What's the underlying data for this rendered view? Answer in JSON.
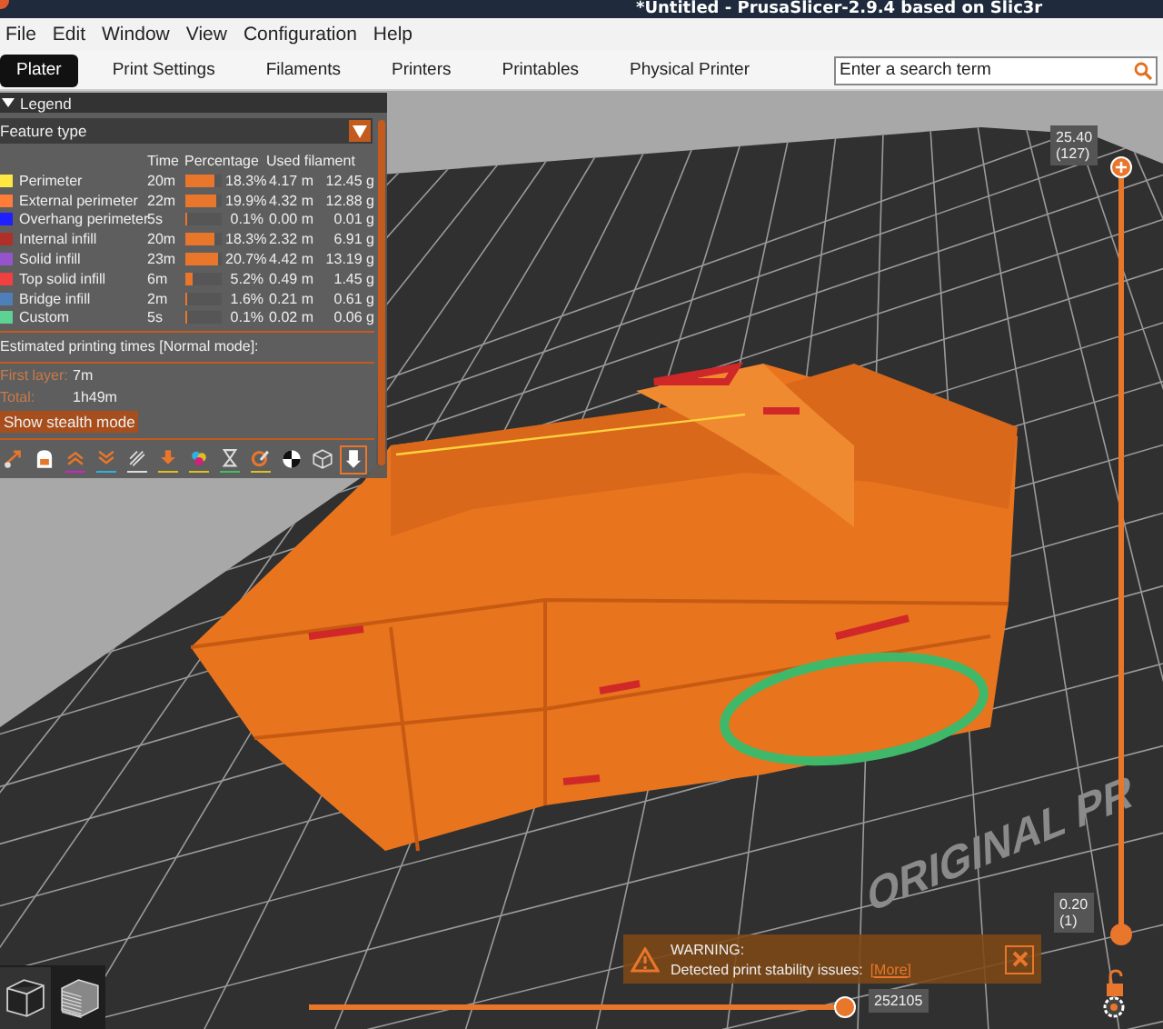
{
  "window": {
    "title": "*Untitled - PrusaSlicer-2.9.4 based on Slic3r"
  },
  "menu": [
    "File",
    "Edit",
    "Window",
    "View",
    "Configuration",
    "Help"
  ],
  "tabs": [
    {
      "label": "Plater",
      "selected": true
    },
    {
      "label": "Print Settings",
      "selected": false
    },
    {
      "label": "Filaments",
      "selected": false
    },
    {
      "label": "Printers",
      "selected": false
    },
    {
      "label": "Printables",
      "selected": false
    },
    {
      "label": "Physical Printer",
      "selected": false
    }
  ],
  "search": {
    "placeholder": "Enter a search term"
  },
  "legend": {
    "title": "Legend",
    "expanded": true,
    "view_type": "Feature type",
    "columns": [
      "Time",
      "Percentage",
      "Used filament"
    ],
    "rows": [
      {
        "name": "Perimeter",
        "color": "#ffe640",
        "time": "20m",
        "level": 0.8,
        "percentage": "18.3%",
        "length": "4.17 m",
        "weight": "12.45 g"
      },
      {
        "name": "External perimeter",
        "color": "#ff7d38",
        "time": "22m",
        "level": 0.87,
        "percentage": "19.9%",
        "length": "4.32 m",
        "weight": "12.88 g"
      },
      {
        "name": "Overhang perimeter",
        "color": "#1f1fff",
        "time": "5s",
        "level": 0.03,
        "percentage": "0.1%",
        "length": "0.00 m",
        "weight": "0.01 g"
      },
      {
        "name": "Internal infill",
        "color": "#b03029",
        "time": "20m",
        "level": 0.8,
        "percentage": "18.3%",
        "length": "2.32 m",
        "weight": "6.91 g"
      },
      {
        "name": "Solid infill",
        "color": "#9654cc",
        "time": "23m",
        "level": 0.9,
        "percentage": "20.7%",
        "length": "4.42 m",
        "weight": "13.19 g"
      },
      {
        "name": "Top solid infill",
        "color": "#f04040",
        "time": "6m",
        "level": 0.23,
        "percentage": "5.2%",
        "length": "0.49 m",
        "weight": "1.45 g"
      },
      {
        "name": "Bridge infill",
        "color": "#4d80ba",
        "time": "2m",
        "level": 0.07,
        "percentage": "1.6%",
        "length": "0.21 m",
        "weight": "0.61 g"
      },
      {
        "name": "Custom",
        "color": "#5ed194",
        "time": "5s",
        "level": 0.03,
        "percentage": "0.1%",
        "length": "0.02 m",
        "weight": "0.06 g"
      }
    ],
    "estimates_title": "Estimated printing times [Normal mode]:",
    "estimates": [
      {
        "label": "First layer:",
        "value": "7m"
      },
      {
        "label": "Total:",
        "value": "1h49m"
      }
    ],
    "mode_button": "Show stealth mode",
    "toolbar": [
      {
        "kind": "travel",
        "selected": false
      },
      {
        "kind": "wipe",
        "selected": false
      },
      {
        "kind": "retractions",
        "selected": false
      },
      {
        "kind": "deretractions",
        "selected": false
      },
      {
        "kind": "seams",
        "selected": false
      },
      {
        "kind": "tool-changes",
        "selected": false
      },
      {
        "kind": "color-changes",
        "selected": false
      },
      {
        "kind": "pause",
        "selected": false
      },
      {
        "kind": "custom-gcode",
        "selected": false
      },
      {
        "kind": "center-of-gravity",
        "selected": false
      },
      {
        "kind": "shells",
        "selected": false
      },
      {
        "kind": "tool-marker",
        "selected": true
      }
    ]
  },
  "bed_text": "ORIGINAL PR",
  "vertical_slider": {
    "level": 1,
    "upper_label": [
      "25.40",
      "(127)"
    ],
    "lower_label": [
      "0.20",
      "(1)"
    ]
  },
  "horizontal_slider": {
    "level": 1,
    "label": "252105"
  },
  "warning": {
    "title": "WARNING:",
    "message": "Detected print stability issues:",
    "link": "[More]"
  },
  "view_buttons": [
    {
      "kind": "wireframe",
      "selected": true
    },
    {
      "kind": "layers",
      "selected": false
    }
  ]
}
